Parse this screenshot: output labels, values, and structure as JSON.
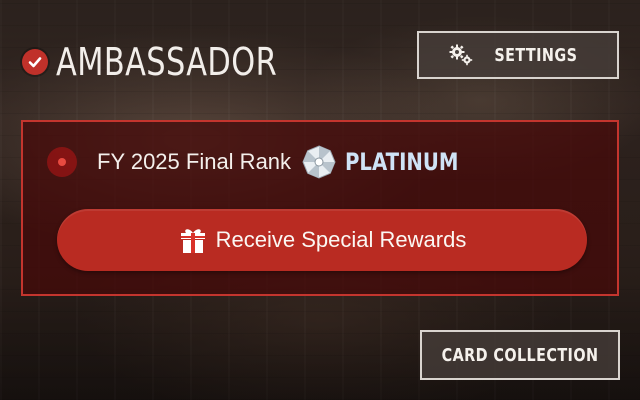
{
  "header": {
    "title": "AMBASSADOR",
    "icon": "check-circle-icon"
  },
  "settings_button": {
    "label": "SETTINGS",
    "icon": "gears-icon"
  },
  "rank_panel": {
    "rank_label": "FY 2025 Final Rank",
    "rank_value": "PLATINUM",
    "rank_icon": "umbrella-emblem-icon",
    "reward_button": {
      "label": "Receive Special Rewards",
      "icon": "gift-icon"
    }
  },
  "card_collection_button": {
    "label": "CARD COLLECTION"
  },
  "colors": {
    "accent_red": "#b92b22",
    "panel_border": "#c4352e",
    "rank_value_color": "#cfe3f6"
  }
}
